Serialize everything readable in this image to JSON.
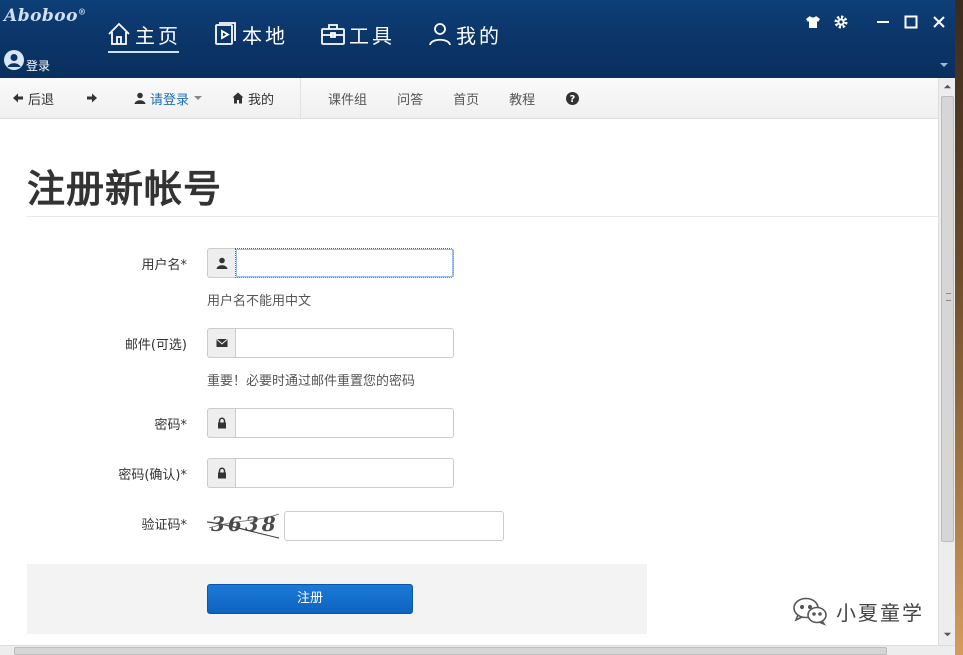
{
  "app": {
    "logo": "Aboboo",
    "logo_mark": "®",
    "tabs": [
      {
        "label": "主页",
        "icon": "home-icon"
      },
      {
        "label": "本地",
        "icon": "media-file-icon"
      },
      {
        "label": "工具",
        "icon": "toolbox-icon"
      },
      {
        "label": "我的",
        "icon": "user-icon"
      }
    ],
    "login_label": "登录",
    "window_controls": [
      "shirt-skin-icon",
      "gear-icon",
      "minimize-icon",
      "maximize-icon",
      "close-icon"
    ]
  },
  "toolbar": {
    "back_label": "后退",
    "forward_icon": "arrow-right-icon",
    "login_label": "请登录",
    "mine_label": "我的",
    "links": [
      "课件组",
      "问答",
      "首页",
      "教程"
    ],
    "help_icon": "question-circle-icon"
  },
  "form": {
    "title": "注册新帐号",
    "username": {
      "label": "用户名*",
      "value": "",
      "help": "用户名不能用中文",
      "icon": "user-icon"
    },
    "email": {
      "label": "邮件(可选)",
      "value": "",
      "help": "重要！必要时通过邮件重置您的密码",
      "icon": "envelope-icon"
    },
    "password": {
      "label": "密码*",
      "value": "",
      "icon": "lock-icon"
    },
    "password_confirm": {
      "label": "密码(确认)*",
      "value": "",
      "icon": "lock-icon"
    },
    "captcha": {
      "label": "验证码*",
      "image_text": "3638",
      "value": ""
    },
    "submit_label": "注册"
  },
  "watermark": {
    "text": "小夏童学",
    "icon": "wechat-icon"
  }
}
